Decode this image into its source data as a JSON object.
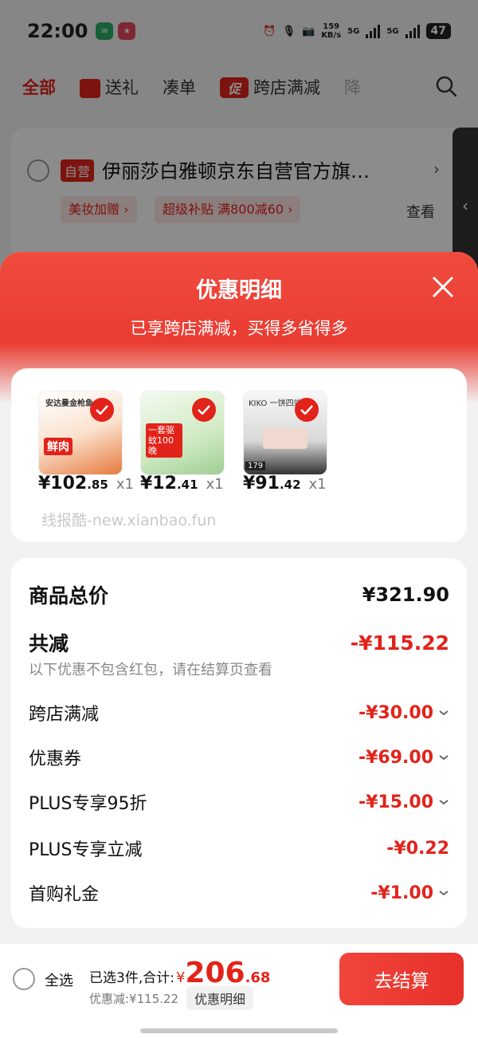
{
  "status_bar": {
    "time": "22:00",
    "speed_value": "159",
    "speed_unit": "KB/s",
    "net1": "5G",
    "net2": "5G",
    "battery": "47"
  },
  "tabs": [
    {
      "label": "全部"
    },
    {
      "label": "送礼"
    },
    {
      "label": "凑单"
    },
    {
      "label": "跨店满减",
      "badge": "促"
    },
    {
      "label": "降"
    }
  ],
  "shop": {
    "self_tag": "自营",
    "name": "伊丽莎白雅顿京东自营官方旗…",
    "chips": [
      "美妆加赠 ›",
      "超级补贴 满800减60 ›"
    ],
    "look": "查看"
  },
  "modal": {
    "title": "优惠明细",
    "subtitle": "已享跨店满减，买得多省得多",
    "products": [
      {
        "price_int": "¥102",
        "price_dec": ".85",
        "qty": "x1",
        "img_text": "安达曼金枪鱼",
        "img_badge": "鲜肉",
        "color": "#f7c9a6"
      },
      {
        "price_int": "¥12",
        "price_dec": ".41",
        "qty": "x1",
        "img_text": "一套驱蚊100晚",
        "img_badge": "",
        "color": "#d6efc7"
      },
      {
        "price_int": "¥91",
        "price_dec": ".42",
        "qty": "x1",
        "img_text": "KIKO 一饼四效",
        "img_badge": "179",
        "color": "#d9d9d9"
      }
    ],
    "watermark": "线报酷-new.xianbao.fun",
    "summary": {
      "total_label": "商品总价",
      "total_value": "¥321.90",
      "reduce_label": "共减",
      "reduce_value": "-¥115.22",
      "reduce_note": "以下优惠不包含红包，请在结算页查看",
      "items": [
        {
          "label": "跨店满减",
          "value": "-¥30.00",
          "expandable": true
        },
        {
          "label": "优惠券",
          "value": "-¥69.00",
          "expandable": true
        },
        {
          "label": "PLUS专享95折",
          "value": "-¥15.00",
          "expandable": true
        },
        {
          "label": "PLUS专享立减",
          "value": "-¥0.22",
          "expandable": false
        },
        {
          "label": "首购礼金",
          "value": "-¥1.00",
          "expandable": true
        }
      ]
    }
  },
  "bottom_bar": {
    "select_all": "全选",
    "selected_text": "已选3件,合计:",
    "currency": "¥",
    "total_int": "206",
    "total_dec": ".68",
    "save_text": "优惠减:¥115.22",
    "detail_chip": "优惠明细",
    "checkout": "去结算"
  },
  "colors": {
    "accent": "#e2231a",
    "header_red": "#ee4035"
  }
}
